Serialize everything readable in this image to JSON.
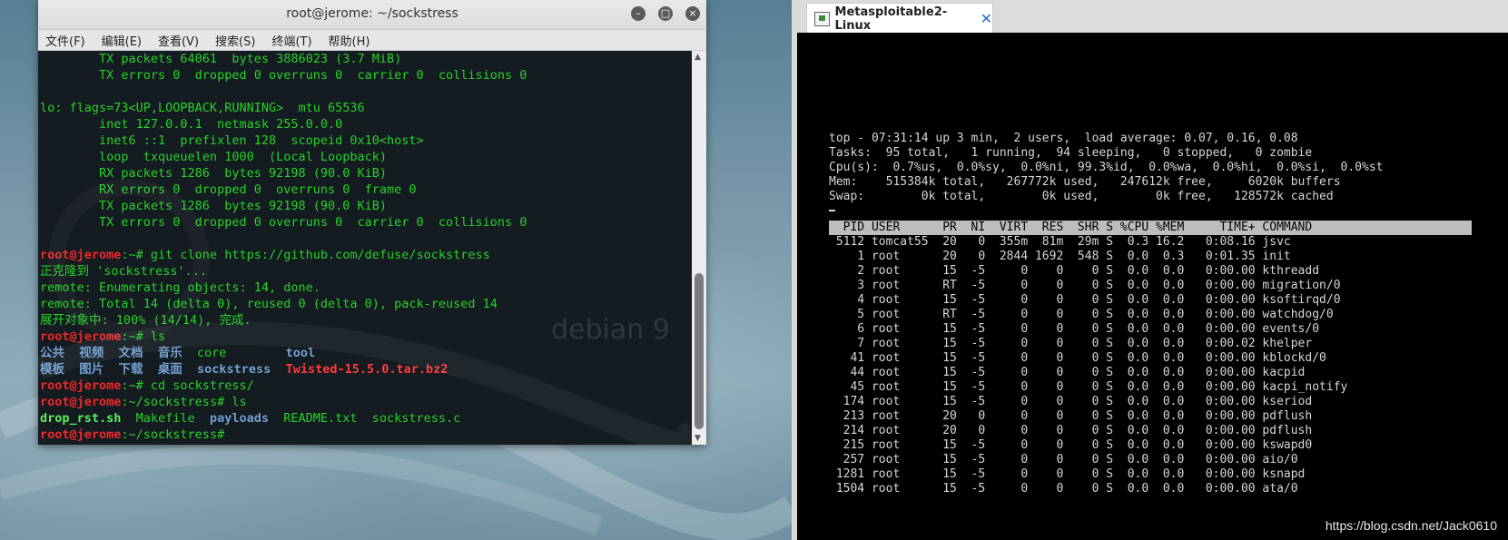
{
  "terminal": {
    "title": "root@jerome: ~/sockstress",
    "menu": [
      "文件(F)",
      "编辑(E)",
      "查看(V)",
      "搜索(S)",
      "终端(T)",
      "帮助(H)"
    ],
    "watermark": "debian 9",
    "lines": [
      {
        "segs": [
          {
            "t": "        TX packets 64061  bytes 3886023 (3.7 MiB)",
            "c": "c-green"
          }
        ]
      },
      {
        "segs": [
          {
            "t": "        TX errors 0  dropped 0 overruns 0  carrier 0  collisions 0",
            "c": "c-green"
          }
        ]
      },
      {
        "segs": [
          {
            "t": "",
            "c": "c-green"
          }
        ]
      },
      {
        "segs": [
          {
            "t": "lo: flags=73<UP,LOOPBACK,RUNNING>  mtu 65536",
            "c": "c-green"
          }
        ]
      },
      {
        "segs": [
          {
            "t": "        inet 127.0.0.1  netmask 255.0.0.0",
            "c": "c-green"
          }
        ]
      },
      {
        "segs": [
          {
            "t": "        inet6 ::1  prefixlen 128  scopeid 0x10<host>",
            "c": "c-green"
          }
        ]
      },
      {
        "segs": [
          {
            "t": "        loop  txqueuelen 1000  (Local Loopback)",
            "c": "c-green"
          }
        ]
      },
      {
        "segs": [
          {
            "t": "        RX packets 1286  bytes 92198 (90.0 KiB)",
            "c": "c-green"
          }
        ]
      },
      {
        "segs": [
          {
            "t": "        RX errors 0  dropped 0  overruns 0  frame 0",
            "c": "c-green"
          }
        ]
      },
      {
        "segs": [
          {
            "t": "        TX packets 1286  bytes 92198 (90.0 KiB)",
            "c": "c-green"
          }
        ]
      },
      {
        "segs": [
          {
            "t": "        TX errors 0  dropped 0 overruns 0  carrier 0  collisions 0",
            "c": "c-green"
          }
        ]
      },
      {
        "segs": [
          {
            "t": "",
            "c": "c-green"
          }
        ]
      },
      {
        "segs": [
          {
            "t": "root@jerome",
            "c": "c-red"
          },
          {
            "t": ":~# git clone https://github.com/defuse/sockstress",
            "c": "c-green"
          }
        ]
      },
      {
        "segs": [
          {
            "t": "正克隆到 'sockstress'...",
            "c": "c-green"
          }
        ]
      },
      {
        "segs": [
          {
            "t": "remote: Enumerating objects: 14, done.",
            "c": "c-green"
          }
        ]
      },
      {
        "segs": [
          {
            "t": "remote: Total 14 (delta 0), reused 0 (delta 0), pack-reused 14",
            "c": "c-green"
          }
        ]
      },
      {
        "segs": [
          {
            "t": "展开对象中: 100% (14/14), 完成.",
            "c": "c-green"
          }
        ]
      },
      {
        "segs": [
          {
            "t": "root@jerome",
            "c": "c-red"
          },
          {
            "t": ":~# ls",
            "c": "c-green"
          }
        ]
      },
      {
        "segs": [
          {
            "t": "公共  视频  文档  音乐  ",
            "c": "c-blue"
          },
          {
            "t": "core        ",
            "c": "c-green"
          },
          {
            "t": "tool",
            "c": "c-blue"
          }
        ]
      },
      {
        "segs": [
          {
            "t": "模板  图片  下载  桌面  sockstress  ",
            "c": "c-blue"
          },
          {
            "t": "Twisted-15.5.0.tar.bz2",
            "c": "c-bred"
          }
        ]
      },
      {
        "segs": [
          {
            "t": "root@jerome",
            "c": "c-red"
          },
          {
            "t": ":~# cd sockstress/",
            "c": "c-green"
          }
        ]
      },
      {
        "segs": [
          {
            "t": "root@jerome",
            "c": "c-red"
          },
          {
            "t": ":~/sockstress# ls",
            "c": "c-green"
          }
        ]
      },
      {
        "segs": [
          {
            "t": "drop_rst.sh",
            "c": "c-bgreen"
          },
          {
            "t": "  Makefile  ",
            "c": "c-green"
          },
          {
            "t": "payloads",
            "c": "c-blue"
          },
          {
            "t": "  README.txt  sockstress.c",
            "c": "c-green"
          }
        ]
      },
      {
        "segs": [
          {
            "t": "root@jerome",
            "c": "c-red"
          },
          {
            "t": ":~/sockstress#",
            "c": "c-green"
          }
        ]
      }
    ]
  },
  "vm": {
    "tab_label": "Metasploitable2-Linux",
    "top_summary": [
      "top - 07:31:14 up 3 min,  2 users,  load average: 0.07, 0.16, 0.08",
      "Tasks:  95 total,   1 running,  94 sleeping,   0 stopped,   0 zombie",
      "Cpu(s):  0.7%us,  0.0%sy,  0.0%ni, 99.3%id,  0.0%wa,  0.0%hi,  0.0%si,  0.0%st",
      "Mem:    515384k total,   267772k used,   247612k free,     6020k buffers",
      "Swap:        0k total,        0k used,        0k free,   128572k cached"
    ],
    "columns": [
      "PID",
      "USER",
      "PR",
      "NI",
      "VIRT",
      "RES",
      "SHR",
      "S",
      "%CPU",
      "%MEM",
      "TIME+",
      "COMMAND"
    ],
    "processes": [
      [
        "5112",
        "tomcat55",
        "20",
        "0",
        "355m",
        "81m",
        "29m",
        "S",
        "0.3",
        "16.2",
        "0:08.16",
        "jsvc"
      ],
      [
        "1",
        "root",
        "20",
        "0",
        "2844",
        "1692",
        "548",
        "S",
        "0.0",
        "0.3",
        "0:01.35",
        "init"
      ],
      [
        "2",
        "root",
        "15",
        "-5",
        "0",
        "0",
        "0",
        "S",
        "0.0",
        "0.0",
        "0:00.00",
        "kthreadd"
      ],
      [
        "3",
        "root",
        "RT",
        "-5",
        "0",
        "0",
        "0",
        "S",
        "0.0",
        "0.0",
        "0:00.00",
        "migration/0"
      ],
      [
        "4",
        "root",
        "15",
        "-5",
        "0",
        "0",
        "0",
        "S",
        "0.0",
        "0.0",
        "0:00.00",
        "ksoftirqd/0"
      ],
      [
        "5",
        "root",
        "RT",
        "-5",
        "0",
        "0",
        "0",
        "S",
        "0.0",
        "0.0",
        "0:00.00",
        "watchdog/0"
      ],
      [
        "6",
        "root",
        "15",
        "-5",
        "0",
        "0",
        "0",
        "S",
        "0.0",
        "0.0",
        "0:00.00",
        "events/0"
      ],
      [
        "7",
        "root",
        "15",
        "-5",
        "0",
        "0",
        "0",
        "S",
        "0.0",
        "0.0",
        "0:00.02",
        "khelper"
      ],
      [
        "41",
        "root",
        "15",
        "-5",
        "0",
        "0",
        "0",
        "S",
        "0.0",
        "0.0",
        "0:00.00",
        "kblockd/0"
      ],
      [
        "44",
        "root",
        "15",
        "-5",
        "0",
        "0",
        "0",
        "S",
        "0.0",
        "0.0",
        "0:00.00",
        "kacpid"
      ],
      [
        "45",
        "root",
        "15",
        "-5",
        "0",
        "0",
        "0",
        "S",
        "0.0",
        "0.0",
        "0:00.00",
        "kacpi_notify"
      ],
      [
        "174",
        "root",
        "15",
        "-5",
        "0",
        "0",
        "0",
        "S",
        "0.0",
        "0.0",
        "0:00.00",
        "kseriod"
      ],
      [
        "213",
        "root",
        "20",
        "0",
        "0",
        "0",
        "0",
        "S",
        "0.0",
        "0.0",
        "0:00.00",
        "pdflush"
      ],
      [
        "214",
        "root",
        "20",
        "0",
        "0",
        "0",
        "0",
        "S",
        "0.0",
        "0.0",
        "0:00.00",
        "pdflush"
      ],
      [
        "215",
        "root",
        "15",
        "-5",
        "0",
        "0",
        "0",
        "S",
        "0.0",
        "0.0",
        "0:00.00",
        "kswapd0"
      ],
      [
        "257",
        "root",
        "15",
        "-5",
        "0",
        "0",
        "0",
        "S",
        "0.0",
        "0.0",
        "0:00.00",
        "aio/0"
      ],
      [
        "1281",
        "root",
        "15",
        "-5",
        "0",
        "0",
        "0",
        "S",
        "0.0",
        "0.0",
        "0:00.00",
        "ksnapd"
      ],
      [
        "1504",
        "root",
        "15",
        "-5",
        "0",
        "0",
        "0",
        "S",
        "0.0",
        "0.0",
        "0:00.00",
        "ata/0"
      ]
    ]
  },
  "watermark_url": "https://blog.csdn.net/Jack0610"
}
